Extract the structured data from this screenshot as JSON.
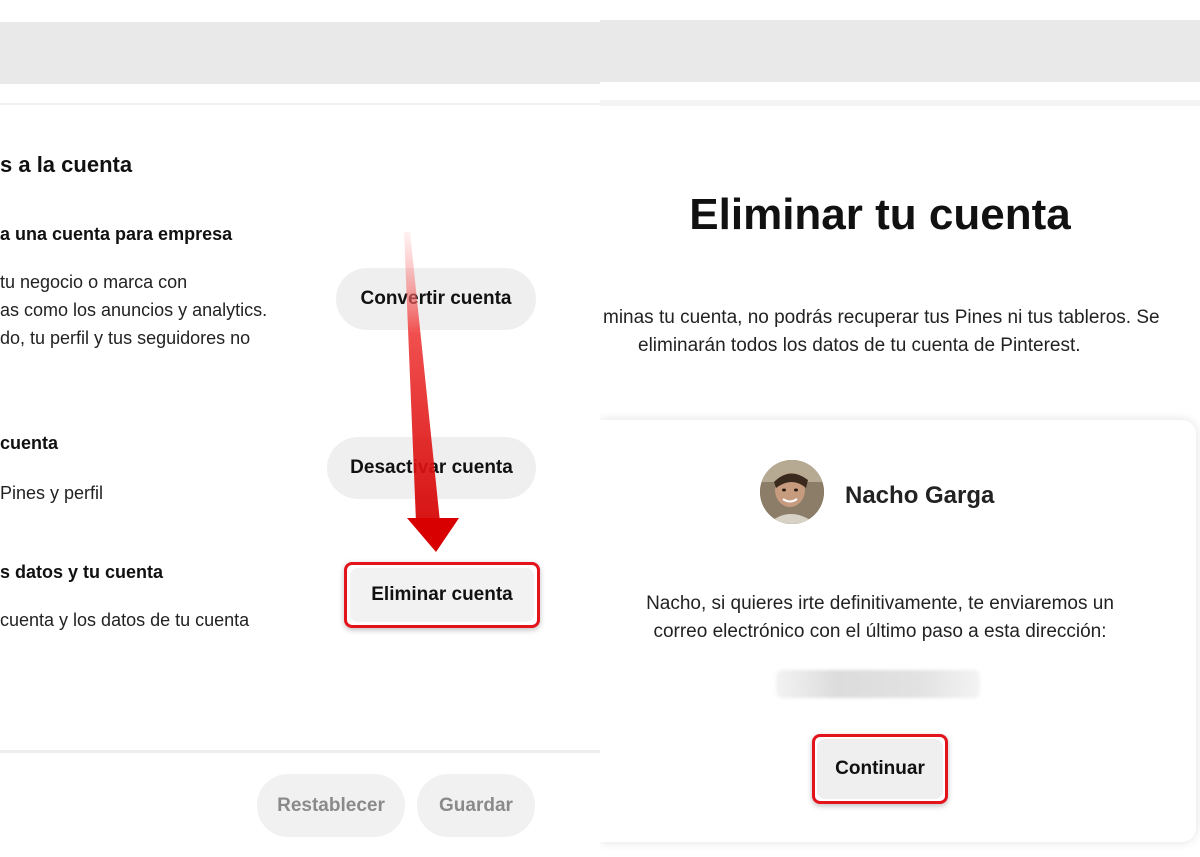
{
  "left": {
    "section_title": "s a la cuenta",
    "options": [
      {
        "title": "a una cuenta para empresa",
        "desc": [
          "tu negocio o marca con",
          "as como los anuncios y analytics.",
          "do, tu perfil y tus seguidores no"
        ],
        "button": "Convertir cuenta"
      },
      {
        "title": "cuenta",
        "desc": [
          "Pines y perfil"
        ],
        "button": "Desactivar cuenta"
      },
      {
        "title": "s datos y tu cuenta",
        "desc": [
          "cuenta y los datos de tu cuenta"
        ],
        "button": "Eliminar cuenta"
      }
    ],
    "footer": {
      "reset_label": "Restablecer",
      "save_label": "Guardar"
    }
  },
  "right": {
    "title": "Eliminar tu cuenta",
    "message": [
      "minas tu cuenta, no podrás recuperar tus Pines ni tus tableros. Se",
      "eliminarán todos los datos de tu cuenta de Pinterest."
    ],
    "user": {
      "name": "Nacho Garga"
    },
    "confirm_message": [
      "Nacho, si quieres irte definitivamente, te enviaremos un",
      "correo electrónico con el último paso a esta dirección:"
    ],
    "continue_label": "Continuar"
  },
  "colors": {
    "highlight": "#e3141b",
    "button_bg": "#efefef",
    "topbar": "#e9e9e9"
  }
}
